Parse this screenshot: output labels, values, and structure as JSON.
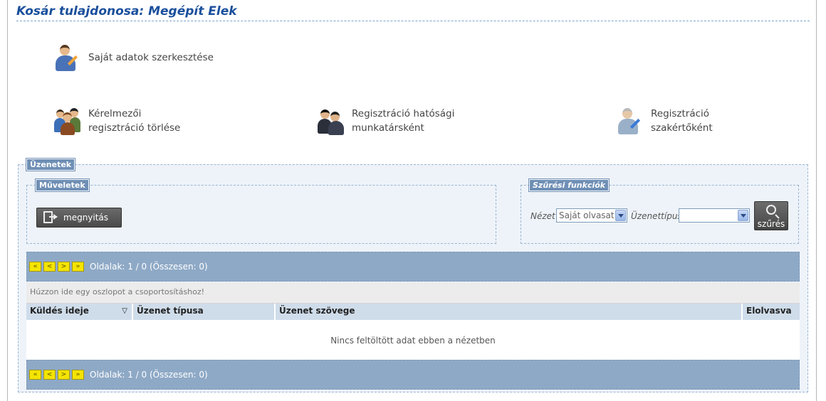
{
  "header": {
    "title": "Kosár tulajdonosa: Megépít Elek"
  },
  "actions": {
    "edit_own": "Saját adatok szerkesztése",
    "delete_reg_line1": "Kérelmezői",
    "delete_reg_line2": "regisztráció törlése",
    "authority_reg_line1": "Regisztráció hatósági",
    "authority_reg_line2": "munkatársként",
    "expert_reg_line1": "Regisztráció",
    "expert_reg_line2": "szakértőként"
  },
  "messages": {
    "legend": "Üzenetek",
    "operations": {
      "legend": "Műveletek",
      "open_label": "megnyitás"
    },
    "filters": {
      "legend": "Szűrési funkciók",
      "view_label": "Nézet",
      "view_value": "Saját olvasat",
      "type_label": "Üzenettípus",
      "type_value": "",
      "search_label": "szűrés"
    },
    "pager": {
      "first": "«",
      "prev": "<",
      "next": ">",
      "last": "»",
      "info": "Oldalak: 1 / 0 (Összesen: 0)"
    },
    "group_hint": "Húzzon ide egy oszlopot a csoportosításhoz!",
    "columns": {
      "sent": "Küldés ideje",
      "sort_icon": "▽",
      "type": "Üzenet típusa",
      "text": "Üzenet szövege",
      "read": "Elolvasva"
    },
    "empty": "Nincs feltöltött adat ebben a nézetben"
  },
  "colors": {
    "title": "#1a4f9c",
    "pager_bg": "#8ea9c6",
    "legend_bg": "#6f8fb5",
    "pager_button": "#f4e400"
  }
}
